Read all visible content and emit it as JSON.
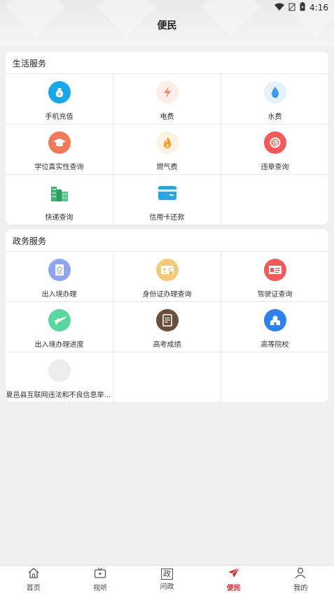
{
  "status_bar": {
    "time": "4:16"
  },
  "header": {
    "title": "便民"
  },
  "life_services": {
    "title": "生活服务",
    "items": [
      {
        "label": "手机充值",
        "icon": "money-bag-icon",
        "color": "#1aa7e8"
      },
      {
        "label": "电费",
        "icon": "lightning-icon",
        "color": "#fdeee9"
      },
      {
        "label": "水费",
        "icon": "water-drop-icon",
        "color": "#e6f1fb"
      },
      {
        "label": "学位真实性查询",
        "icon": "graduation-cap-icon",
        "color": "#ef7a5a"
      },
      {
        "label": "燃气费",
        "icon": "flame-icon",
        "color": "#fdf3e3"
      },
      {
        "label": "违章查询",
        "icon": "violation-icon",
        "color": "#f05a5a"
      },
      {
        "label": "快递查询",
        "icon": "buildings-icon",
        "color": "#3cb371"
      },
      {
        "label": "信用卡还款",
        "icon": "credit-card-icon",
        "color": "#2aa5e0"
      }
    ]
  },
  "gov_services": {
    "title": "政务服务",
    "items": [
      {
        "label": "出入境办理",
        "icon": "passport-icon",
        "color": "#8fa5f0"
      },
      {
        "label": "身份证办理查询",
        "icon": "id-card-icon",
        "color": "#f5c97a"
      },
      {
        "label": "驾驶证查询",
        "icon": "driver-license-icon",
        "color": "#f05a5a"
      },
      {
        "label": "出入境办理进度",
        "icon": "plane-icon",
        "color": "#5cd6a0"
      },
      {
        "label": "高考成绩",
        "icon": "score-sheet-icon",
        "color": "#6b4f3a"
      },
      {
        "label": "高等院校",
        "icon": "university-icon",
        "color": "#2f80ed"
      },
      {
        "label": "夏邑县互联网违法和不良信息举报…",
        "icon": "placeholder-icon",
        "color": "#ececec"
      }
    ]
  },
  "tabbar": {
    "items": [
      {
        "label": "首页",
        "icon": "home-icon"
      },
      {
        "label": "视听",
        "icon": "tv-icon"
      },
      {
        "label": "问政",
        "icon": "politics-icon",
        "glyph": "政"
      },
      {
        "label": "便民",
        "icon": "send-icon"
      },
      {
        "label": "我的",
        "icon": "person-icon"
      }
    ],
    "active": "便民",
    "active_color": "#e0292e"
  }
}
